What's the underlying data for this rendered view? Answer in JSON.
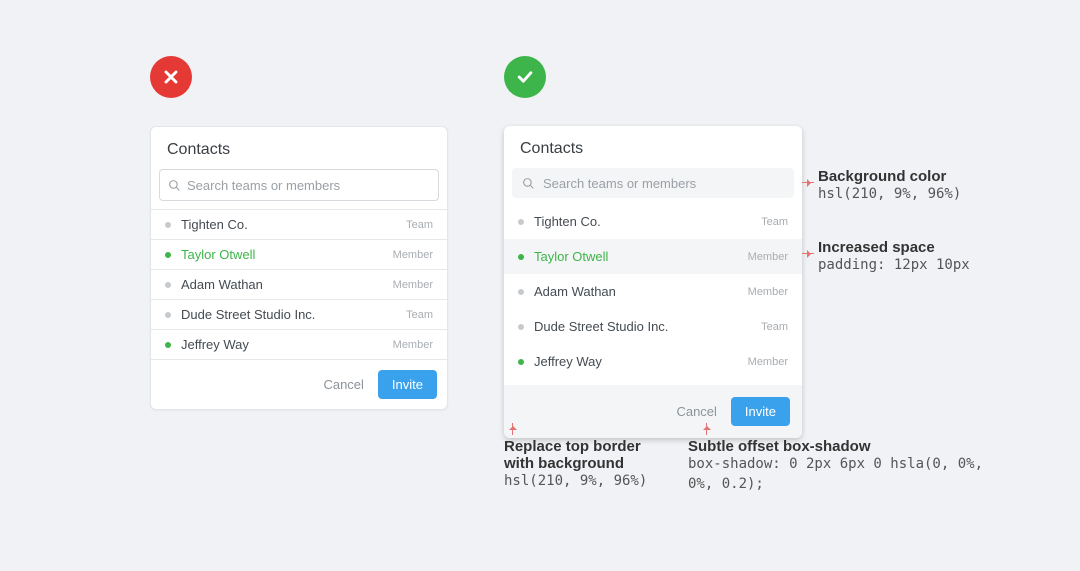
{
  "left": {
    "title": "Contacts",
    "search_placeholder": "Search teams or members",
    "rows": [
      {
        "name": "Tighten Co.",
        "tag": "Team",
        "dot": "grey",
        "selected": false
      },
      {
        "name": "Taylor Otwell",
        "tag": "Member",
        "dot": "green",
        "selected": true
      },
      {
        "name": "Adam Wathan",
        "tag": "Member",
        "dot": "grey",
        "selected": false
      },
      {
        "name": "Dude Street Studio Inc.",
        "tag": "Team",
        "dot": "grey",
        "selected": false
      },
      {
        "name": "Jeffrey Way",
        "tag": "Member",
        "dot": "green",
        "selected": false
      }
    ],
    "cancel": "Cancel",
    "invite": "Invite"
  },
  "right": {
    "title": "Contacts",
    "search_placeholder": "Search teams or members",
    "rows": [
      {
        "name": "Tighten Co.",
        "tag": "Team",
        "dot": "grey",
        "selected": false
      },
      {
        "name": "Taylor Otwell",
        "tag": "Member",
        "dot": "green",
        "selected": true
      },
      {
        "name": "Adam Wathan",
        "tag": "Member",
        "dot": "grey",
        "selected": false
      },
      {
        "name": "Dude Street Studio Inc.",
        "tag": "Team",
        "dot": "grey",
        "selected": false
      },
      {
        "name": "Jeffrey Way",
        "tag": "Member",
        "dot": "green",
        "selected": false
      }
    ],
    "cancel": "Cancel",
    "invite": "Invite"
  },
  "annotations": {
    "bg_head": "Background color",
    "bg_code": "hsl(210, 9%, 96%)",
    "space_head": "Increased space",
    "space_code": "padding: 12px 10px",
    "border_head": "Replace top border with background",
    "border_code": "hsl(210, 9%, 96%)",
    "shadow_head": "Subtle offset box-shadow",
    "shadow_code": "box-shadow: 0 2px 6px 0 hsla(0, 0%, 0%, 0.2);"
  }
}
